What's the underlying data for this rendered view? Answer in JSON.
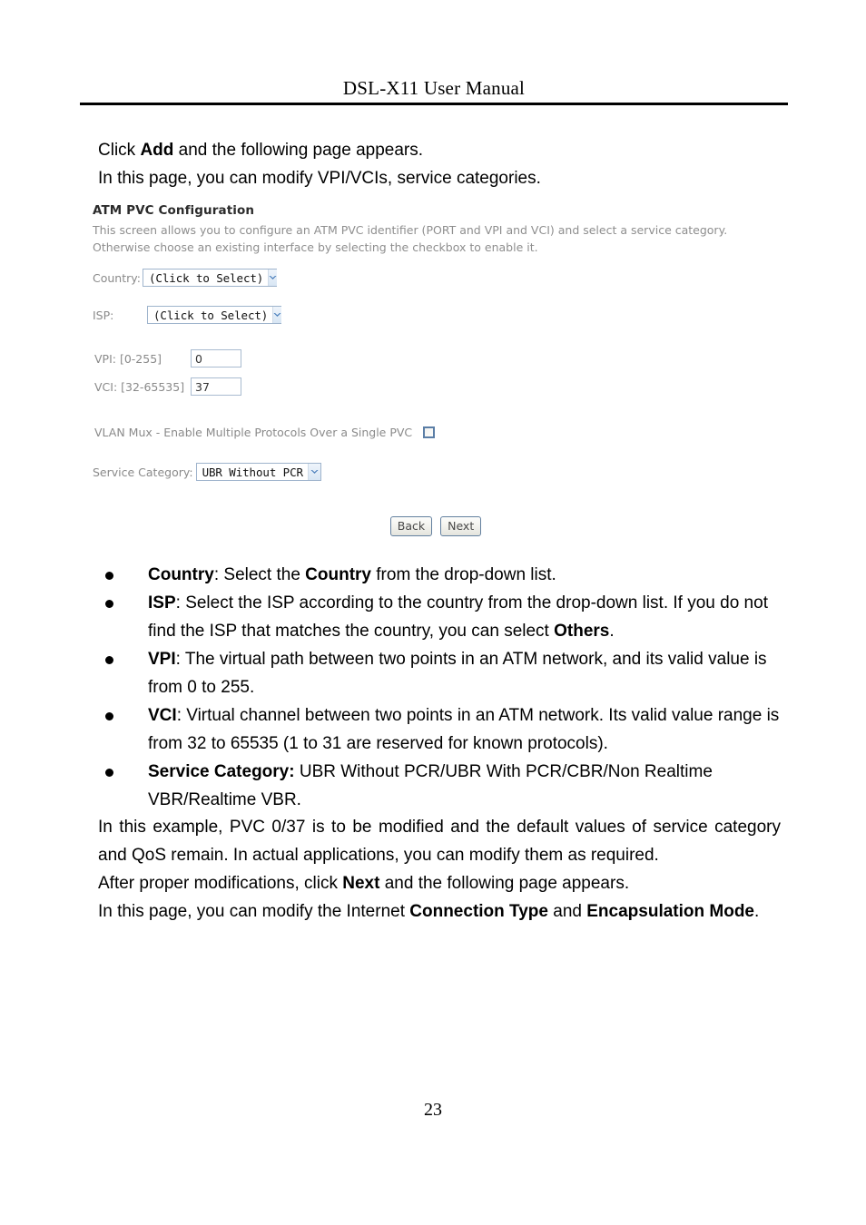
{
  "header": {
    "running_title": "DSL-X11 User Manual"
  },
  "intro": {
    "line1_pre": "Click ",
    "line1_bold": "Add",
    "line1_post": " and the following page appears.",
    "line2": "In this page, you can modify VPI/VCIs, service categories."
  },
  "webui": {
    "title": "ATM PVC Configuration",
    "description": "This screen allows you to configure an ATM PVC identifier (PORT and VPI and VCI) and select a service category. Otherwise choose an existing interface by selecting the checkbox to enable it.",
    "country": {
      "label": "Country:",
      "value": "(Click to Select)",
      "icon": "chevron-down-icon"
    },
    "isp": {
      "label": "ISP:",
      "value": "(Click to Select)",
      "icon": "chevron-down-icon"
    },
    "vpi": {
      "label": "VPI: [0-255]",
      "value": "0"
    },
    "vci": {
      "label": "VCI: [32-65535]",
      "value": "37"
    },
    "vlan_mux": {
      "label": "VLAN Mux - Enable Multiple Protocols Over a Single PVC",
      "checked": false
    },
    "service_category": {
      "label": "Service Category:",
      "value": "UBR Without PCR",
      "icon": "chevron-down-icon"
    },
    "buttons": {
      "back": "Back",
      "next": "Next"
    },
    "colors": {
      "select_border": "#9fb4cc",
      "input_border": "#a9bbd0",
      "arrow_fill": "#4a7ebb",
      "label_gray": "#8a8a8a",
      "desc_gray": "#8e8e8e",
      "button_border": "#63809f"
    }
  },
  "bullets": [
    {
      "term": "Country",
      "sep": ": ",
      "text_a": "Select the ",
      "emph": "Country",
      "text_b": " from the drop-down list."
    },
    {
      "term": "ISP",
      "sep": ": ",
      "text_a": "Select the ISP according to the country from the drop-down list. If you do not find the ISP that matches the country, you can select ",
      "emph": "Others",
      "text_b": "."
    },
    {
      "term": "VPI",
      "sep": ": ",
      "text_a": "The virtual path between two points in an ATM network, and its valid value is from 0 to 255.",
      "emph": "",
      "text_b": ""
    },
    {
      "term": "VCI",
      "sep": ": ",
      "text_a": "Virtual channel between two points in an ATM network. Its valid value range is from 32 to 65535 (1 to 31 are reserved for known protocols).",
      "emph": "",
      "text_b": ""
    },
    {
      "term": "Service Category:",
      "sep": " ",
      "text_a": "UBR Without PCR/UBR With PCR/CBR/Non Realtime VBR/Realtime VBR.",
      "emph": "",
      "text_b": ""
    }
  ],
  "tail": {
    "para1": "In this example, PVC 0/37 is to be modified and the default values of service category and QoS remain. In actual applications, you can modify them as required.",
    "para2_pre": "After proper modifications, click ",
    "para2_bold": "Next",
    "para2_post": " and the following page appears.",
    "para3_pre": "In this page, you can modify the Internet ",
    "para3_bold1": "Connection Type",
    "para3_mid": " and ",
    "para3_bold2": "Encapsulation Mode",
    "para3_post": "."
  },
  "folio": {
    "page_number": "23"
  }
}
